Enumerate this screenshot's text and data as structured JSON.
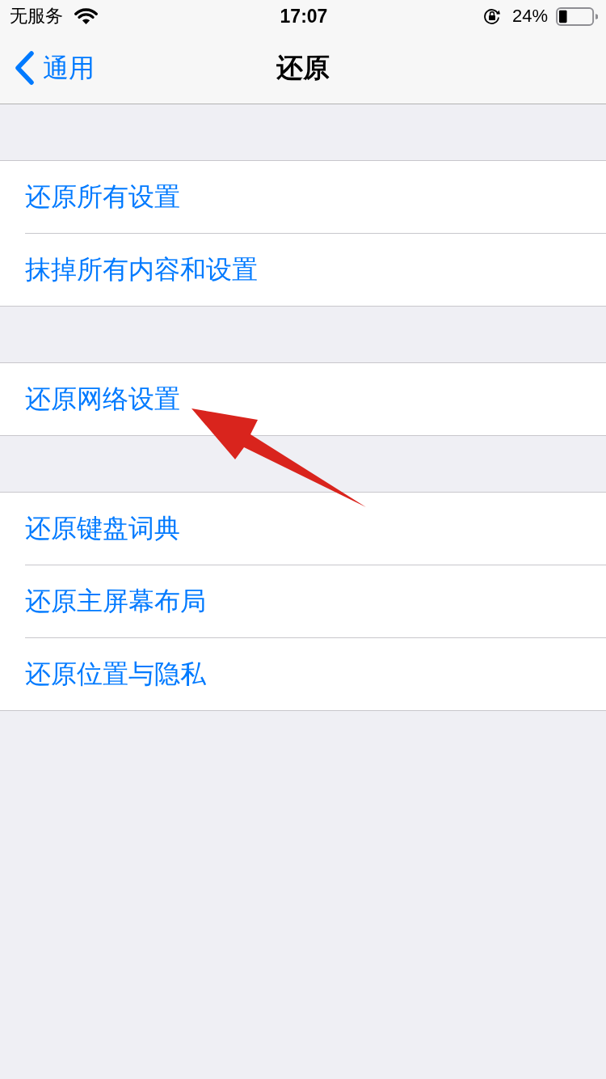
{
  "status_bar": {
    "carrier": "无服务",
    "time": "17:07",
    "battery_percent": "24%"
  },
  "nav_bar": {
    "back_label": "通用",
    "title": "还原"
  },
  "sections": [
    {
      "items": [
        {
          "label": "还原所有设置"
        },
        {
          "label": "抹掉所有内容和设置"
        }
      ]
    },
    {
      "items": [
        {
          "label": "还原网络设置"
        }
      ]
    },
    {
      "items": [
        {
          "label": "还原键盘词典"
        },
        {
          "label": "还原主屏幕布局"
        },
        {
          "label": "还原位置与隐私"
        }
      ]
    }
  ]
}
